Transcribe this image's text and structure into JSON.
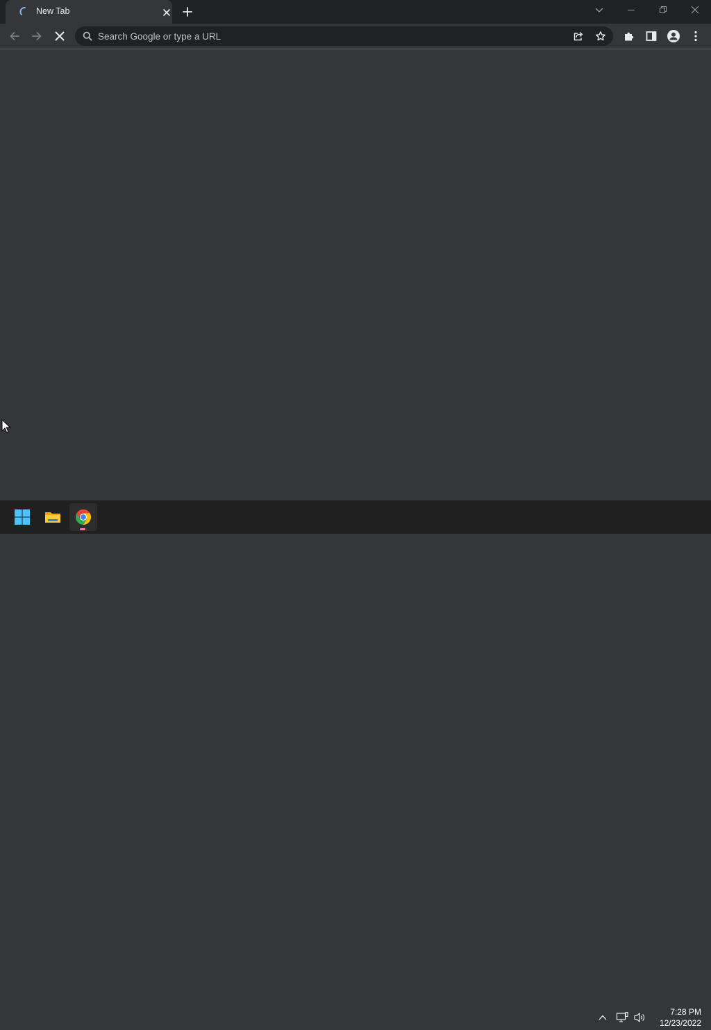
{
  "tab": {
    "title": "New Tab"
  },
  "omnibox": {
    "placeholder": "Search Google or type a URL",
    "value": ""
  },
  "taskbar": {
    "clock_time": "7:28 PM",
    "clock_date": "12/23/2022",
    "apps": [
      "start-menu",
      "file-explorer",
      "google-chrome"
    ]
  },
  "icons": {
    "tab": [
      "loading-spinner-icon",
      "close-icon",
      "plus-icon"
    ],
    "window": [
      "tab-search-icon",
      "minimize-icon",
      "restore-icon",
      "close-icon"
    ],
    "toolbar": [
      "back-arrow-icon",
      "forward-arrow-icon",
      "stop-icon",
      "search-icon",
      "share-icon",
      "star-icon",
      "puzzle-icon",
      "side-panel-icon",
      "profile-icon",
      "more-vertical-icon"
    ],
    "tray": [
      "chevron-up-icon",
      "network-icon",
      "volume-icon"
    ]
  },
  "colors": {
    "frame": "#202124",
    "toolbar": "#35363a",
    "omnibox": "#202124",
    "text": "#e8eaed",
    "spinner": "#8ab4f8",
    "taskbar": "#202020"
  }
}
